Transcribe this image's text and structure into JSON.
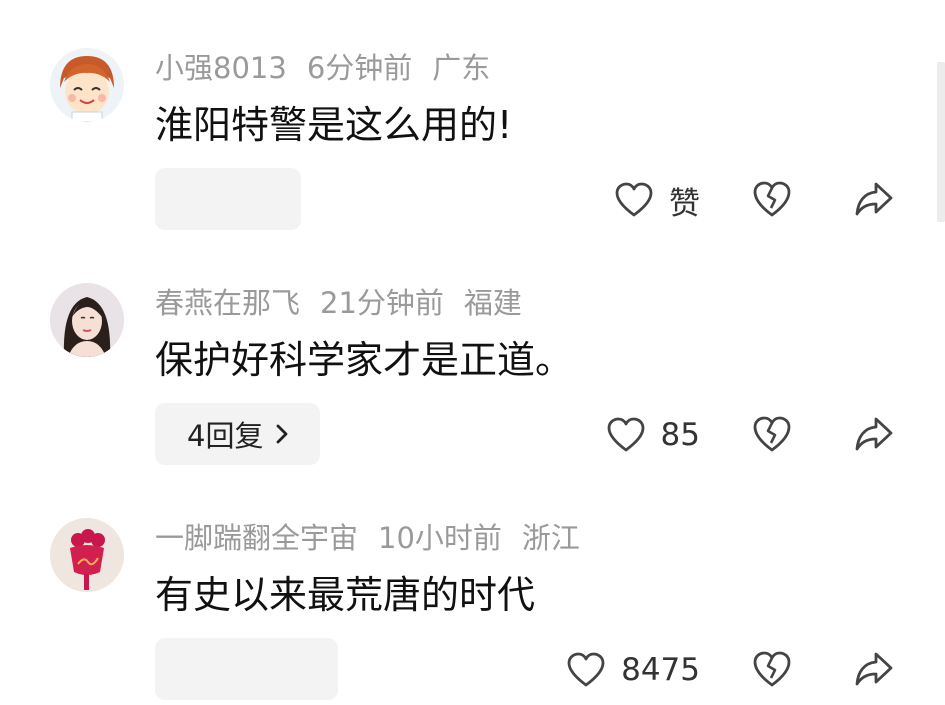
{
  "comments": [
    {
      "username": "小强8013",
      "time": "6分钟前",
      "location": "广东",
      "text": "淮阳特警是这么用的!",
      "reply_label": "",
      "like_label": "赞",
      "avatar": "cartoon-boy-avatar"
    },
    {
      "username": "春燕在那飞",
      "time": "21分钟前",
      "location": "福建",
      "text": "保护好科学家才是正道。",
      "reply_label": "4回复",
      "like_label": "85",
      "avatar": "woman-photo-avatar"
    },
    {
      "username": "一脚踹翻全宇宙",
      "time": "10小时前",
      "location": "浙江",
      "text": "有史以来最荒唐的时代",
      "reply_label": "",
      "like_label": "8475",
      "avatar": "red-flower-avatar"
    }
  ],
  "icons": {
    "like": "heart-icon",
    "dislike": "broken-heart-icon",
    "share": "share-arrow-icon",
    "reply_more": "chevron-right-icon"
  },
  "colors": {
    "meta_text": "#9a9a9a",
    "reply_box": "#f3f3f3"
  }
}
